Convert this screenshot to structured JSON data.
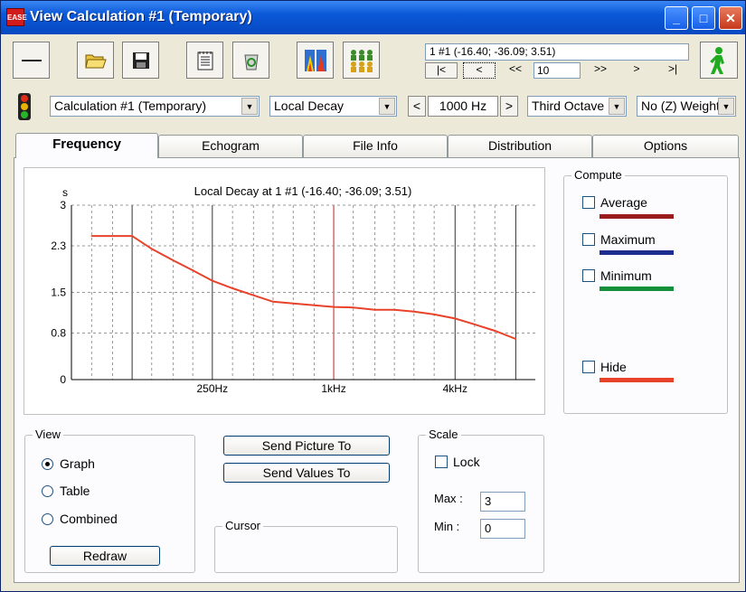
{
  "window": {
    "logo_text": "EASE",
    "title": "View Calculation #1 (Temporary)",
    "minimize": "_",
    "maximize": "□",
    "close": "✕"
  },
  "nav": {
    "position_value": "1 #1  (-16.40; -36.09; 3.51)",
    "first": "|<",
    "prev": "<",
    "prev_step": "<<",
    "step_value": "10",
    "next_step": ">>",
    "next": ">",
    "last": ">|"
  },
  "selectors": {
    "calculation": "Calculation #1 (Temporary)",
    "parameter": "Local Decay",
    "freq_prev": "<",
    "frequency": "1000 Hz",
    "freq_next": ">",
    "band": "Third Octave",
    "weighting": "No (Z) Weight"
  },
  "tabs": [
    "Frequency",
    "Echogram",
    "File Info",
    "Distribution",
    "Options"
  ],
  "compute": {
    "title": "Compute",
    "items": [
      {
        "label": "Average",
        "color": "#9b1c1c"
      },
      {
        "label": "Maximum",
        "color": "#1c2d8f"
      },
      {
        "label": "Minimum",
        "color": "#14903a"
      },
      {
        "label": "Hide",
        "color": "#e8432a"
      }
    ]
  },
  "view": {
    "title": "View",
    "options": [
      "Graph",
      "Table",
      "Combined"
    ],
    "selected": "Graph",
    "redraw": "Redraw"
  },
  "actions": {
    "send_picture": "Send Picture To",
    "send_values": "Send Values To"
  },
  "cursor": {
    "title": "Cursor"
  },
  "scale": {
    "title": "Scale",
    "lock_label": "Lock",
    "max_label": "Max :",
    "max_value": "3",
    "min_label": "Min :",
    "min_value": "0"
  },
  "chart_data": {
    "type": "line",
    "title": "Local Decay at 1 #1  (-16.40; -36.09; 3.51)",
    "ylabel": "s",
    "ylim": [
      0,
      3
    ],
    "yticks": [
      "0",
      "0.8",
      "1.5",
      "2.3",
      "3"
    ],
    "xticks": [
      "250Hz",
      "1kHz",
      "4kHz"
    ],
    "xscale": "log",
    "xlim": [
      50,
      10000
    ],
    "grid": true,
    "series": [
      {
        "color": "#e8432a",
        "x": [
          63,
          80,
          100,
          125,
          160,
          200,
          250,
          315,
          400,
          500,
          630,
          800,
          1000,
          1250,
          1600,
          2000,
          2500,
          3150,
          4000,
          5000,
          6300,
          8000
        ],
        "y": [
          2.47,
          2.47,
          2.47,
          2.25,
          2.05,
          1.88,
          1.7,
          1.57,
          1.45,
          1.34,
          1.31,
          1.28,
          1.25,
          1.24,
          1.2,
          1.2,
          1.17,
          1.12,
          1.05,
          0.95,
          0.84,
          0.7
        ]
      }
    ]
  }
}
